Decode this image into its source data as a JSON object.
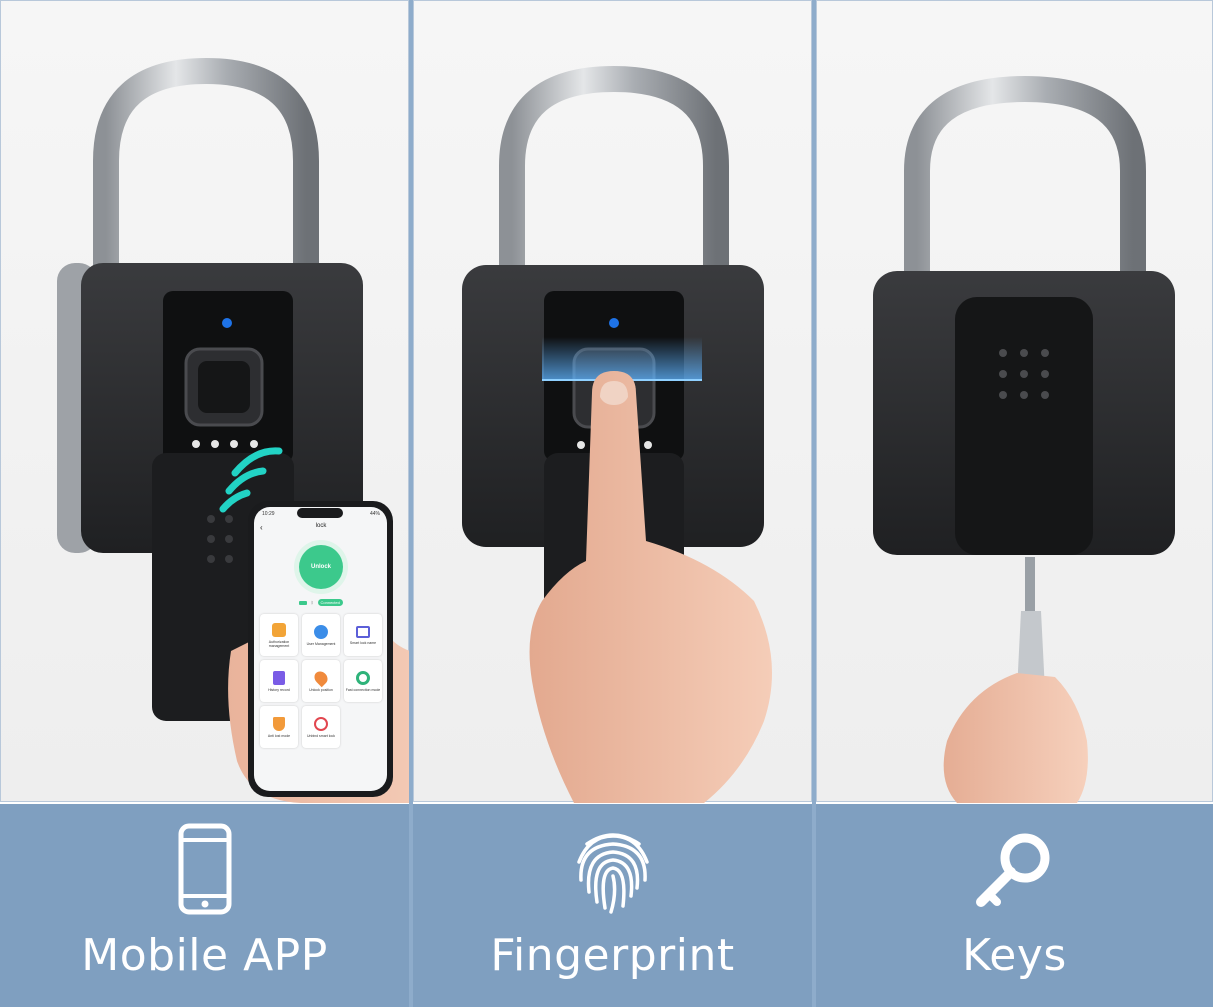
{
  "panels": [
    {
      "label": "Mobile APP",
      "icon": "smartphone-icon",
      "phone": {
        "time": "10:29",
        "battery": "44%",
        "screen_title": "lock",
        "unlock_label": "Unlock",
        "status_badge": "Connected",
        "tiles": [
          {
            "label": "Authorization management",
            "icon": "authorization-icon"
          },
          {
            "label": "User Management",
            "icon": "user-management-icon"
          },
          {
            "label": "Smart lock name",
            "icon": "lock-name-icon"
          },
          {
            "label": "History record",
            "icon": "history-icon"
          },
          {
            "label": "Unlock position",
            "icon": "location-pin-icon"
          },
          {
            "label": "Fast connection mode",
            "icon": "share-icon"
          },
          {
            "label": "Anti lost mode",
            "icon": "shield-icon"
          },
          {
            "label": "Unbind smart lock",
            "icon": "unbind-icon"
          }
        ]
      }
    },
    {
      "label": "Fingerprint",
      "icon": "fingerprint-icon"
    },
    {
      "label": "Keys",
      "icon": "key-icon"
    }
  ],
  "colors": {
    "label_bar": "#7f9fc0",
    "lock_body": "#2b2c2e",
    "shackle": "#b5b8bc",
    "accent_teal": "#22d3c5",
    "indicator_blue": "#1e73e8",
    "unlock_green": "#3cc98c"
  }
}
